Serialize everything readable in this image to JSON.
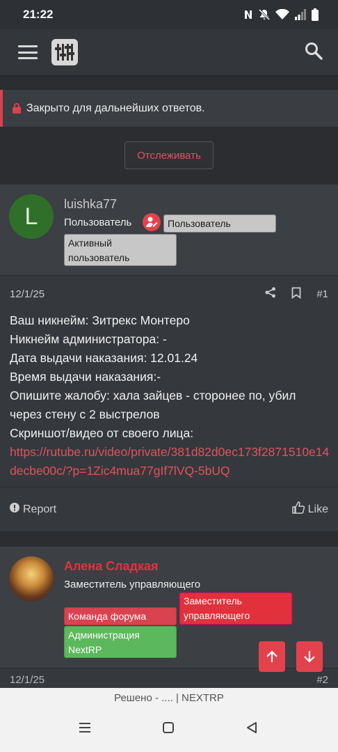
{
  "status": {
    "time": "21:22"
  },
  "notice": {
    "text": "Закрыто для дальнейших ответов."
  },
  "watch_button": "Отслеживать",
  "post1": {
    "avatar_letter": "L",
    "username": "luishka77",
    "title": "Пользователь",
    "badges": [
      "Пользователь",
      "Активный пользователь"
    ],
    "date": "12/1/25",
    "number": "#1",
    "lines": [
      "Ваш никнейм: Зитрекс Монтеро",
      "Никнейм администратора: -",
      "Дата выдачи наказания: 12.01.24",
      "Время выдачи наказания:-",
      "Опишите жалобу: хала зайцев - сторонее по, убил через стену с 2 выстрелов",
      "Скриншот/видео от своего лица:"
    ],
    "link": "https://rutube.ru/video/private/381d82d0ec173f2871510e14decbe00c/?p=1Zic4mua77gIf7lVQ-5bUQ",
    "report": "Report",
    "like": "Like"
  },
  "post2": {
    "username": "Алена Сладкая",
    "title": "Заместитель управляющего",
    "badges": [
      "Заместитель управляющего",
      "Команда форума",
      "Администрация NextRP"
    ],
    "date": "12/1/25",
    "number": "#2"
  },
  "browser": {
    "url_text": "Решено - .... | NEXTRP"
  },
  "colors": {
    "accent": "#e3424d",
    "background": "#2b2d31"
  }
}
